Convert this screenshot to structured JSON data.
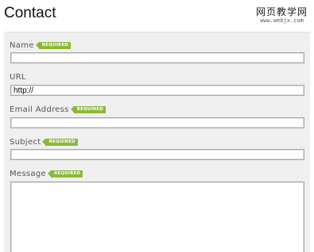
{
  "page": {
    "title": "Contact"
  },
  "watermark": {
    "text_cn": "网页教学网",
    "url": "www.webjx.com"
  },
  "form": {
    "required_badge": "REQUIRED",
    "name": {
      "label": "Name",
      "value": ""
    },
    "url": {
      "label": "URL",
      "value": "http://"
    },
    "email": {
      "label": "Email Address",
      "value": ""
    },
    "subject": {
      "label": "Subject",
      "value": ""
    },
    "message": {
      "label": "Message",
      "value": ""
    }
  },
  "colors": {
    "badge": "#8cb83a",
    "panel_background": "#efefef",
    "input_border": "#a9a9a9"
  }
}
